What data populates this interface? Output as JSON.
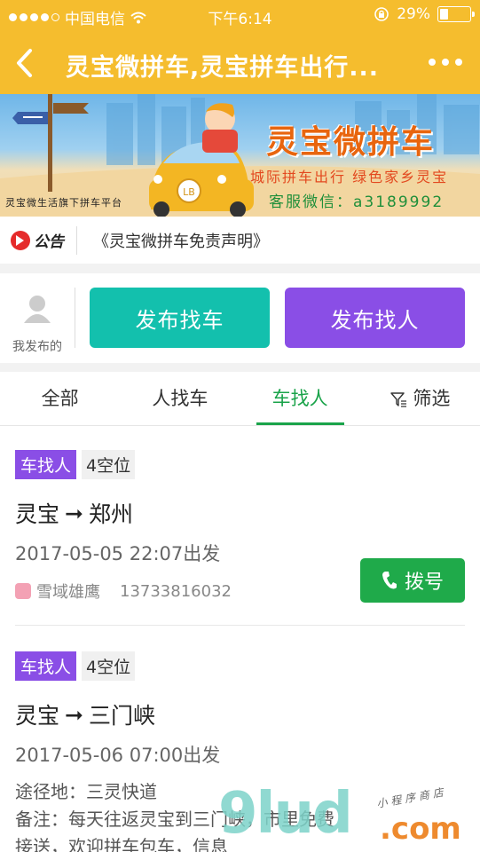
{
  "status_bar": {
    "carrier": "中国电信",
    "time": "下午6:14",
    "battery": "29%",
    "battery_level": 0.29
  },
  "nav": {
    "title": "灵宝微拼车,灵宝拼车出行...",
    "back_icon": "chevron-left-icon",
    "more_icon": "more-dots-icon"
  },
  "banner": {
    "brand": "灵宝微拼车",
    "slogan": "城际拼车出行 绿色家乡灵宝",
    "service": "客服微信：a3189992",
    "tagline": "灵宝微生活旗下拼车平台",
    "car_badge": "LB"
  },
  "notice": {
    "badge_label": "公告",
    "text": "《灵宝微拼车免责声明》"
  },
  "publish": {
    "mine_label": "我发布的",
    "find_car": "发布找车",
    "find_person": "发布找人",
    "colors": {
      "find_car": "#13c0ad",
      "find_person": "#8a4ee6"
    }
  },
  "tabs": [
    {
      "label": "全部",
      "active": false
    },
    {
      "label": "人找车",
      "active": false
    },
    {
      "label": "车找人",
      "active": true
    },
    {
      "label": "筛选",
      "active": false,
      "icon": "filter-icon"
    }
  ],
  "listings": [
    {
      "type": "车找人",
      "seats": "4空位",
      "from": "灵宝",
      "to": "郑州",
      "departure": "2017-05-05 22:07出发",
      "user": "雪域雄鹰",
      "phone": "13733816032",
      "dial_label": "拨号"
    },
    {
      "type": "车找人",
      "seats": "4空位",
      "from": "灵宝",
      "to": "三门峡",
      "departure": "2017-05-06 07:00出发",
      "via": "途径地：三灵快道",
      "note": "备注：每天往返灵宝到三门峡，市里免费接送，欢迎拼车包车，信息"
    }
  ],
  "watermark": {
    "text": "9lud",
    "suffix": ".com",
    "sub": "小程序商店"
  }
}
